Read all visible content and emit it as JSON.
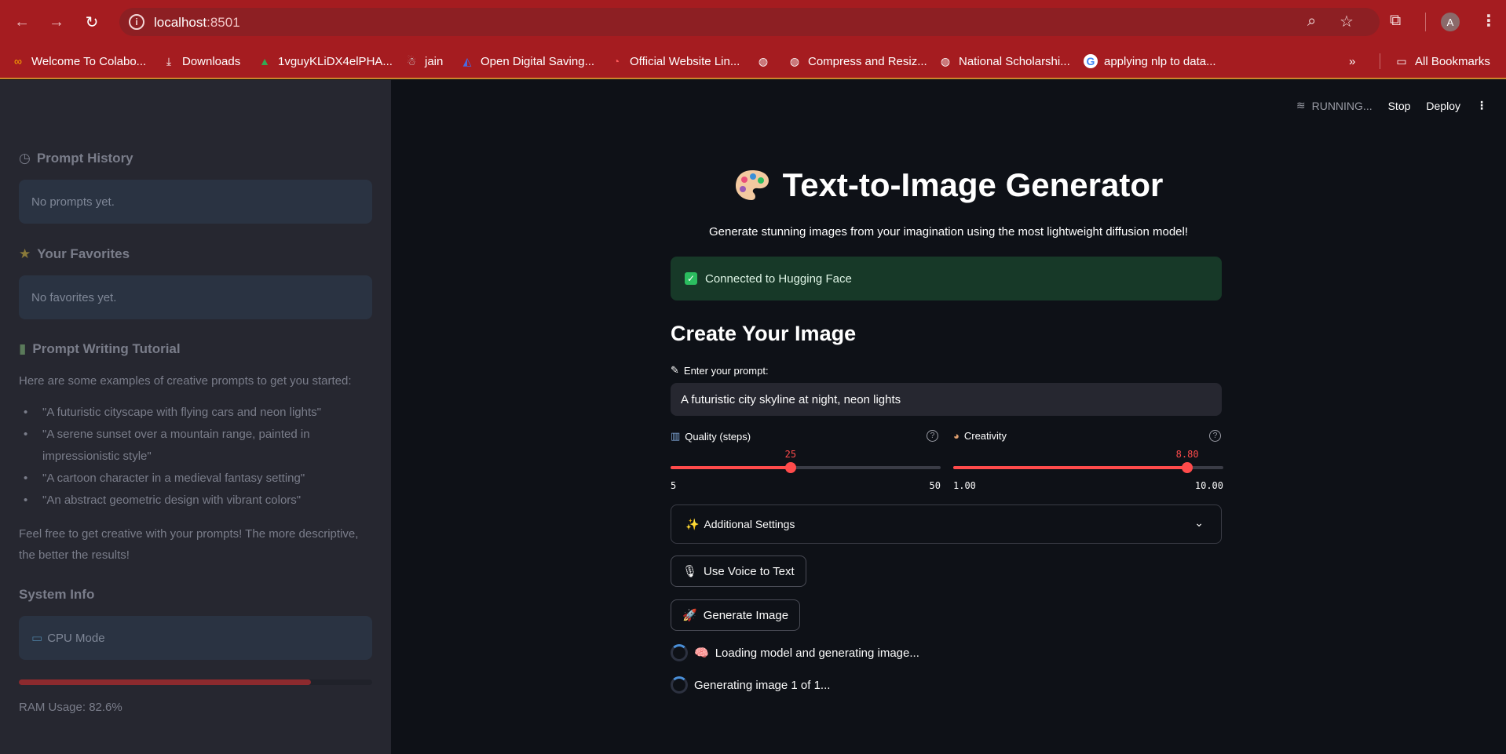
{
  "browser": {
    "url_host": "localhost",
    "url_port": ":8501",
    "profile_initial": "A",
    "bookmarks": [
      {
        "label": "Welcome To Colabo...",
        "icon": "colab-icon"
      },
      {
        "label": "Downloads",
        "icon": "download-icon"
      },
      {
        "label": "1vguyKLiDX4elPHA...",
        "icon": "drive-icon"
      },
      {
        "label": "jain",
        "icon": "robot-icon"
      },
      {
        "label": "Open Digital Saving...",
        "icon": "bank-icon"
      },
      {
        "label": "Official Website Lin...",
        "icon": "website-icon"
      },
      {
        "label": "",
        "icon": "globe-icon"
      },
      {
        "label": "Compress and Resiz...",
        "icon": "globe-icon"
      },
      {
        "label": "National Scholarshi...",
        "icon": "globe-icon"
      },
      {
        "label": "applying nlp to data...",
        "icon": "google-icon"
      }
    ],
    "all_bookmarks": "All Bookmarks"
  },
  "sidebar": {
    "history_heading": "Prompt History",
    "history_empty": "No prompts yet.",
    "favorites_heading": "Your Favorites",
    "favorites_empty": "No favorites yet.",
    "tutorial_heading": "Prompt Writing Tutorial",
    "tutorial_intro": "Here are some examples of creative prompts to get you started:",
    "examples": [
      "\"A futuristic cityscape with flying cars and neon lights\"",
      "\"A serene sunset over a mountain range, painted in impressionistic style\"",
      "\"A cartoon character in a medieval fantasy setting\"",
      "\"An abstract geometric design with vibrant colors\""
    ],
    "tutorial_outro": "Feel free to get creative with your prompts! The more descriptive, the better the results!",
    "system_heading": "System Info",
    "mode": "CPU Mode",
    "ram_fraction": 0.826,
    "ram_label": "RAM Usage: 82.6%"
  },
  "header": {
    "running": "RUNNING...",
    "stop": "Stop",
    "deploy": "Deploy"
  },
  "main": {
    "title": "Text-to-Image Generator",
    "subtitle": "Generate stunning images from your imagination using the most lightweight diffusion model!",
    "connection": "Connected to Hugging Face",
    "section_title": "Create Your Image",
    "prompt_label": "Enter your prompt:",
    "prompt_value": "A futuristic city skyline at night, neon lights",
    "quality": {
      "label": "Quality (steps)",
      "value": 25,
      "value_text": "25",
      "min": 5,
      "max": 50,
      "min_text": "5",
      "max_text": "50"
    },
    "creativity": {
      "label": "Creativity",
      "value": 8.8,
      "value_text": "8.80",
      "min": 1,
      "max": 10,
      "min_text": "1.00",
      "max_text": "10.00"
    },
    "additional_settings": "Additional Settings",
    "voice_button": "Use Voice to Text",
    "generate_button": "Generate Image",
    "status_loading": "Loading model and generating image...",
    "status_progress": "Generating image 1 of 1..."
  },
  "colors": {
    "chrome_red": "#a51c20",
    "accent": "#ff4b4b",
    "sidebar_bg": "#262730",
    "main_bg": "#0e1117",
    "success_bg": "#173928"
  }
}
